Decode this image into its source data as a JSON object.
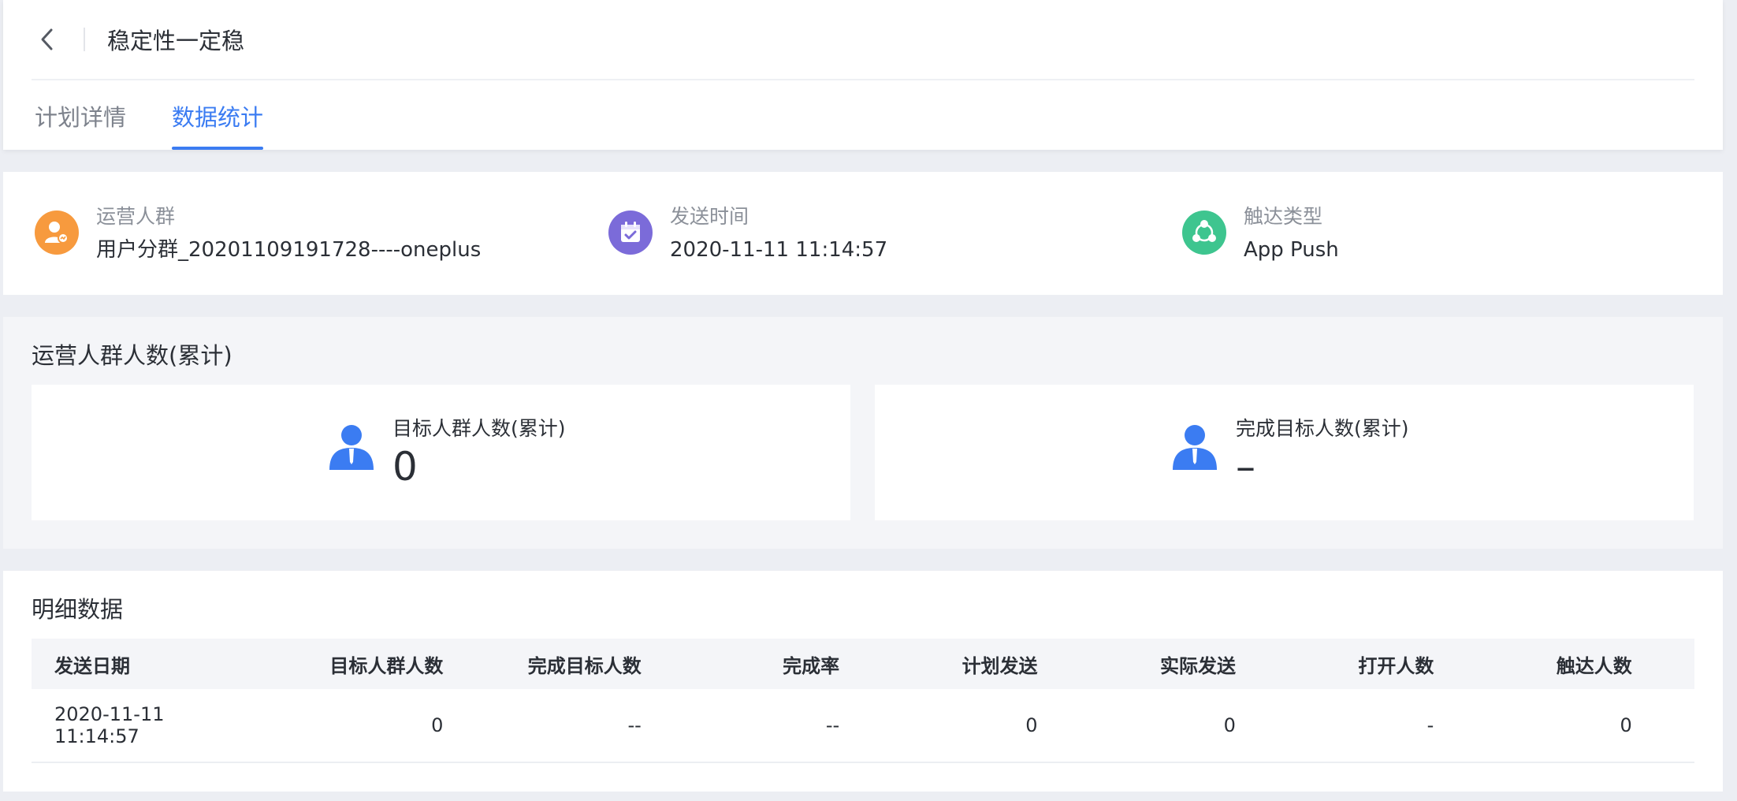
{
  "header": {
    "title": "稳定性一定稳",
    "tabs": [
      {
        "label": "计划详情",
        "active": false
      },
      {
        "label": "数据统计",
        "active": true
      }
    ]
  },
  "info": [
    {
      "label": "运营人群",
      "value": "用户分群_20201109191728----oneplus",
      "icon": "user-group-icon",
      "color": "#f79a3e"
    },
    {
      "label": "发送时间",
      "value": "2020-11-11 11:14:57",
      "icon": "calendar-check-icon",
      "color": "#7b6bd9"
    },
    {
      "label": "触达类型",
      "value": "App Push",
      "icon": "share-icon",
      "color": "#3ec58f"
    }
  ],
  "metrics": {
    "title": "运营人群人数(累计)",
    "cards": [
      {
        "label": "目标人群人数(累计)",
        "value": "0"
      },
      {
        "label": "完成目标人数(累计)",
        "value": "–"
      }
    ]
  },
  "detail": {
    "title": "明细数据",
    "columns": [
      "发送日期",
      "目标人群人数",
      "完成目标人数",
      "完成率",
      "计划发送",
      "实际发送",
      "打开人数",
      "触达人数"
    ],
    "rows": [
      [
        "2020-11-11 11:14:57",
        "0",
        "--",
        "--",
        "0",
        "0",
        "-",
        "0"
      ]
    ]
  },
  "colors": {
    "accent": "#3b7cf2",
    "person_icon": "#3b7cf2"
  }
}
